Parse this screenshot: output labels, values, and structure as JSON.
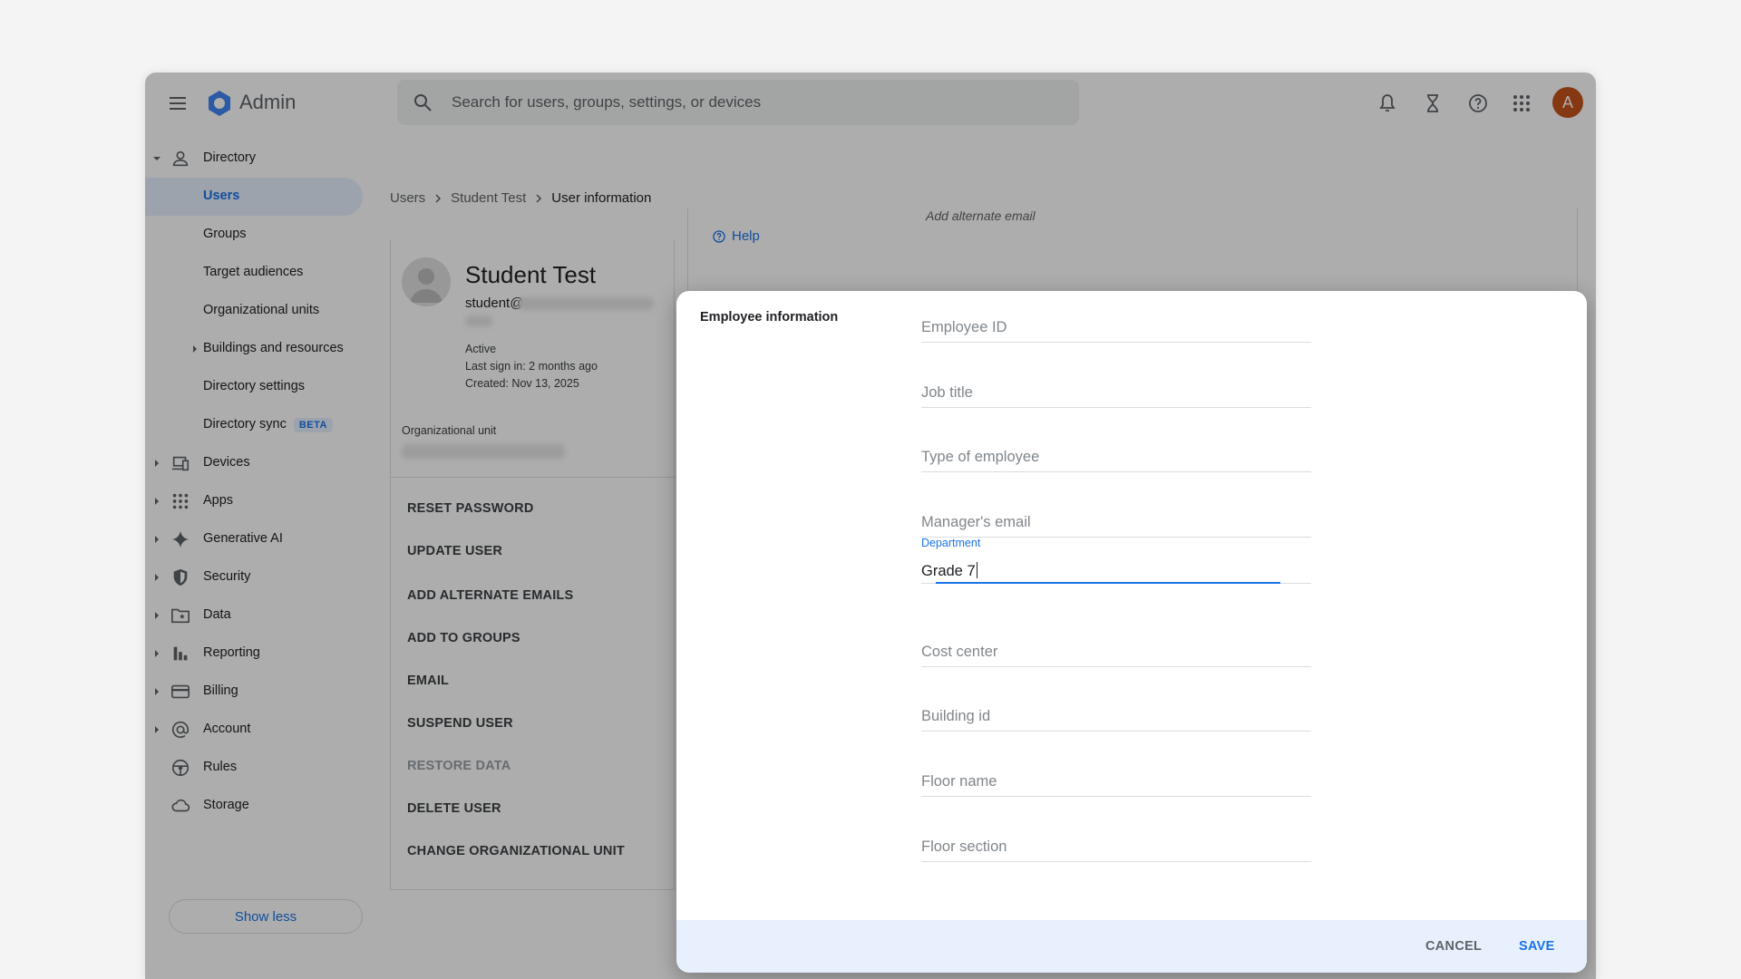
{
  "app": {
    "name": "Admin"
  },
  "search": {
    "placeholder": "Search for users, groups, settings, or devices"
  },
  "topbar": {
    "avatar_letter": "A"
  },
  "sidebar": {
    "items": [
      {
        "label": "Directory"
      },
      {
        "label": "Users"
      },
      {
        "label": "Groups"
      },
      {
        "label": "Target audiences"
      },
      {
        "label": "Organizational units"
      },
      {
        "label": "Buildings and resources"
      },
      {
        "label": "Directory settings"
      },
      {
        "label": "Directory sync",
        "badge": "BETA"
      },
      {
        "label": "Devices"
      },
      {
        "label": "Apps"
      },
      {
        "label": "Generative AI"
      },
      {
        "label": "Security"
      },
      {
        "label": "Data"
      },
      {
        "label": "Reporting"
      },
      {
        "label": "Billing"
      },
      {
        "label": "Account"
      },
      {
        "label": "Rules"
      },
      {
        "label": "Storage"
      }
    ],
    "show_less": "Show less"
  },
  "breadcrumb": {
    "items": [
      "Users",
      "Student Test",
      "User information"
    ]
  },
  "user": {
    "name": "Student Test",
    "email_prefix": "student@",
    "status": "Active",
    "last_sign_in": "Last sign in: 2 months ago",
    "created": "Created: Nov 13, 2025",
    "org_unit_label": "Organizational unit"
  },
  "actions": [
    "RESET PASSWORD",
    "UPDATE USER",
    "ADD ALTERNATE EMAILS",
    "ADD TO GROUPS",
    "EMAIL",
    "SUSPEND USER",
    "RESTORE DATA",
    "DELETE USER",
    "CHANGE ORGANIZATIONAL UNIT"
  ],
  "background_panel": {
    "partial_text": "Add alternate email",
    "help": "Help"
  },
  "dialog": {
    "title": "Employee information",
    "fields": {
      "employee_id": "Employee ID",
      "job_title": "Job title",
      "type_of_employee": "Type of employee",
      "managers_email": "Manager's email",
      "department_label": "Department",
      "department_value": "Grade 7",
      "cost_center": "Cost center",
      "building_id": "Building id",
      "floor_name": "Floor name",
      "floor_section": "Floor section"
    },
    "cancel": "CANCEL",
    "save": "SAVE"
  },
  "colors": {
    "accent": "#1a73e8",
    "avatar": "#c5531b",
    "active_nav_bg": "#e8f0fe",
    "dialog_footer_bg": "#e8f0fe"
  }
}
